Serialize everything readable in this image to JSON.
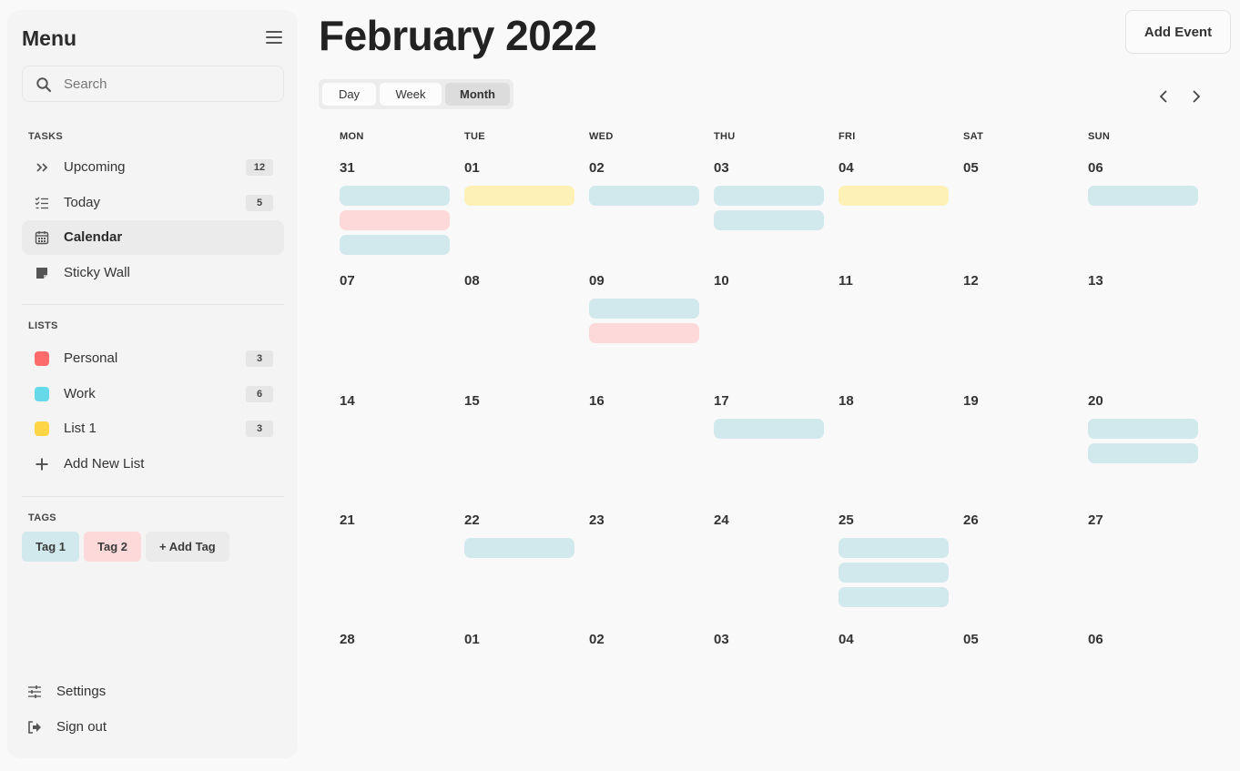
{
  "colors": {
    "personal": "#fe6b6b",
    "work": "#66d9e8",
    "list1": "#fed544",
    "tag1": "#d1e8ec",
    "tag2": "#fdd9d9",
    "event_blue": "#d1e8ec",
    "event_pink": "#fdd9d9",
    "event_yellow": "#fef1b6"
  },
  "sidebar": {
    "title": "Menu",
    "search_placeholder": "Search",
    "tasks_heading": "TASKS",
    "tasks": [
      {
        "icon": "double-chevron-right-icon",
        "label": "Upcoming",
        "count": "12"
      },
      {
        "icon": "checklist-icon",
        "label": "Today",
        "count": "5"
      },
      {
        "icon": "calendar-icon",
        "label": "Calendar",
        "active": true
      },
      {
        "icon": "sticky-note-icon",
        "label": "Sticky Wall"
      }
    ],
    "lists_heading": "LISTS",
    "lists": [
      {
        "label": "Personal",
        "count": "3"
      },
      {
        "label": "Work",
        "count": "6"
      },
      {
        "label": "List 1",
        "count": "3"
      }
    ],
    "add_list_label": "Add New List",
    "tags_heading": "TAGS",
    "tags": [
      "Tag 1",
      "Tag 2",
      "+ Add Tag"
    ],
    "settings_label": "Settings",
    "signout_label": "Sign out"
  },
  "header": {
    "title": "February 2022",
    "add_event_label": "Add Event",
    "views": [
      "Day",
      "Week",
      "Month"
    ],
    "active_view": "Month"
  },
  "calendar": {
    "weekdays": [
      "MON",
      "TUE",
      "WED",
      "THU",
      "FRI",
      "SAT",
      "SUN"
    ],
    "weeks": [
      [
        "31",
        "01",
        "02",
        "03",
        "04",
        "05",
        "06"
      ],
      [
        "07",
        "08",
        "09",
        "10",
        "11",
        "12",
        "13"
      ],
      [
        "14",
        "15",
        "16",
        "17",
        "18",
        "19",
        "20"
      ],
      [
        "21",
        "22",
        "23",
        "24",
        "25",
        "26",
        "27"
      ],
      [
        "28",
        "01",
        "02",
        "03",
        "04",
        "05",
        "06"
      ]
    ],
    "events": [
      {
        "week": 0,
        "day": 0,
        "colors": [
          "blue",
          "pink",
          "blue"
        ]
      },
      {
        "week": 0,
        "day": 1,
        "colors": [
          "yellow"
        ]
      },
      {
        "week": 0,
        "day": 2,
        "colors": [
          "blue"
        ]
      },
      {
        "week": 0,
        "day": 3,
        "colors": [
          "blue",
          "blue"
        ]
      },
      {
        "week": 0,
        "day": 4,
        "colors": [
          "yellow"
        ]
      },
      {
        "week": 0,
        "day": 6,
        "colors": [
          "blue"
        ]
      },
      {
        "week": 1,
        "day": 2,
        "colors": [
          "blue",
          "pink"
        ]
      },
      {
        "week": 2,
        "day": 3,
        "colors": [
          "blue"
        ]
      },
      {
        "week": 2,
        "day": 6,
        "colors": [
          "blue",
          "blue"
        ]
      },
      {
        "week": 3,
        "day": 1,
        "colors": [
          "blue"
        ]
      },
      {
        "week": 3,
        "day": 4,
        "colors": [
          "blue",
          "blue",
          "blue"
        ]
      }
    ]
  }
}
